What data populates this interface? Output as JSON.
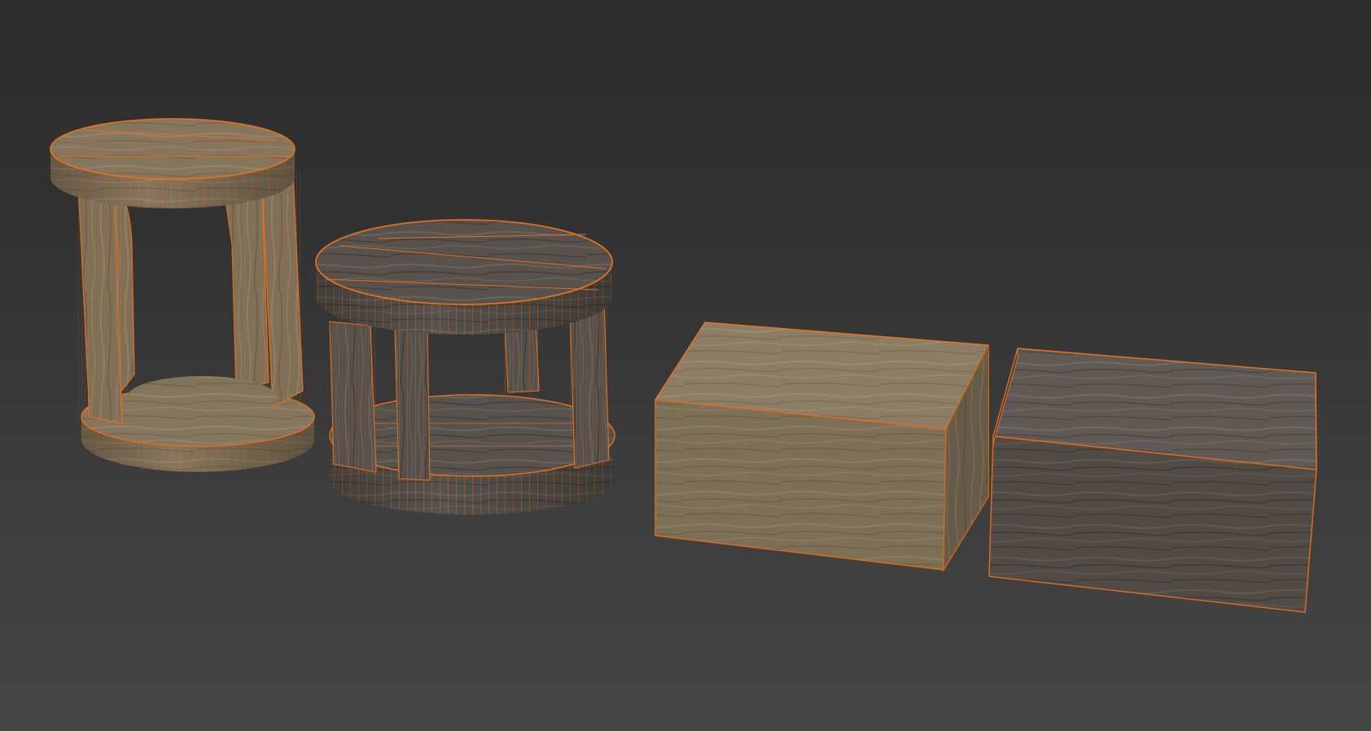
{
  "viewport": {
    "background_top": "#2c2c2c",
    "background_bottom": "#454545",
    "selection_wire_color": "#e2701e"
  },
  "objects": [
    {
      "id": "tall-stool",
      "kind": "round stool, open sides",
      "material": "light-wood"
    },
    {
      "id": "low-stool",
      "kind": "round stool, open sides",
      "material": "dark-wood"
    },
    {
      "id": "box-light",
      "kind": "rectangular block",
      "material": "light-wood"
    },
    {
      "id": "box-dark",
      "kind": "rectangular block",
      "material": "dark-wood"
    }
  ],
  "materials": {
    "light-wood": {
      "base": "#7d6e58",
      "light": "#9a8a70",
      "dark": "#5f5343"
    },
    "dark-wood": {
      "base": "#5a5550",
      "light": "#6e6862",
      "dark": "#403b37"
    }
  }
}
